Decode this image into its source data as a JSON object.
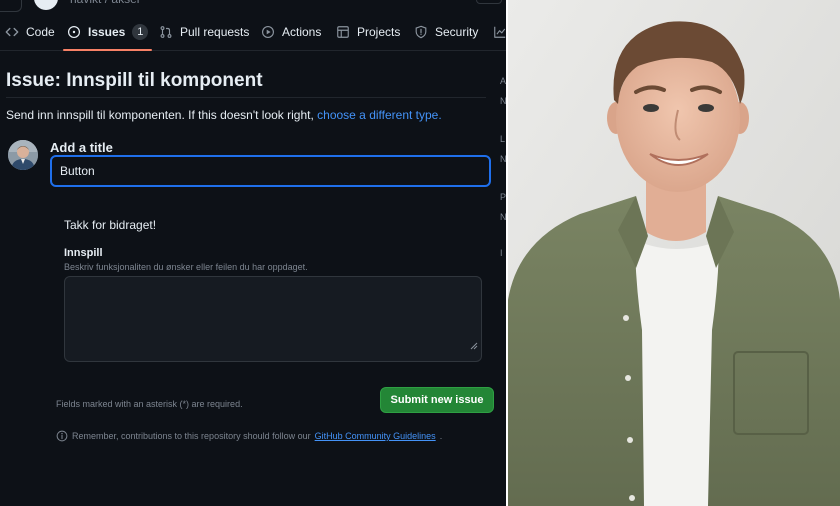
{
  "header": {
    "breadcrumb_owner": "navikt",
    "breadcrumb_separator": "/",
    "breadcrumb_repo": "aksel"
  },
  "tabs": [
    {
      "label": "Code",
      "icon": "code-icon"
    },
    {
      "label": "Issues",
      "icon": "issue-opened-icon",
      "counter": "1",
      "active": true
    },
    {
      "label": "Pull requests",
      "icon": "git-pull-request-icon"
    },
    {
      "label": "Actions",
      "icon": "play-icon"
    },
    {
      "label": "Projects",
      "icon": "table-icon"
    },
    {
      "label": "Security",
      "icon": "shield-icon"
    },
    {
      "label": "",
      "icon": "graph-icon"
    }
  ],
  "sidebar_peek": [
    "A",
    "N",
    "L",
    "N",
    "P",
    "N",
    "I"
  ],
  "page": {
    "title": "Issue: Innspill til komponent",
    "subtitle_text": "Send inn innspill til komponenten. If this doesn't look right,",
    "subtitle_link": "choose a different type."
  },
  "form": {
    "add_title_label": "Add a title",
    "title_value": "Button",
    "intro_text": "Takk for bidraget!",
    "field_label": "Innspill",
    "field_description": "Beskriv funksjonaliten du ønsker eller feilen du har oppdaget.",
    "field_value": "",
    "required_note": "Fields marked with an asterisk (*) are required.",
    "submit_label": "Submit new issue",
    "guidelines_text": "Remember, contributions to this repository should follow our",
    "guidelines_link": "GitHub Community Guidelines",
    "guidelines_suffix": "."
  },
  "colors": {
    "background": "#0d1117",
    "accent_link": "#4493f8",
    "focus_border": "#1f6feb",
    "tab_underline": "#f78166",
    "submit_button": "#238636",
    "muted_text": "#7d8590"
  }
}
